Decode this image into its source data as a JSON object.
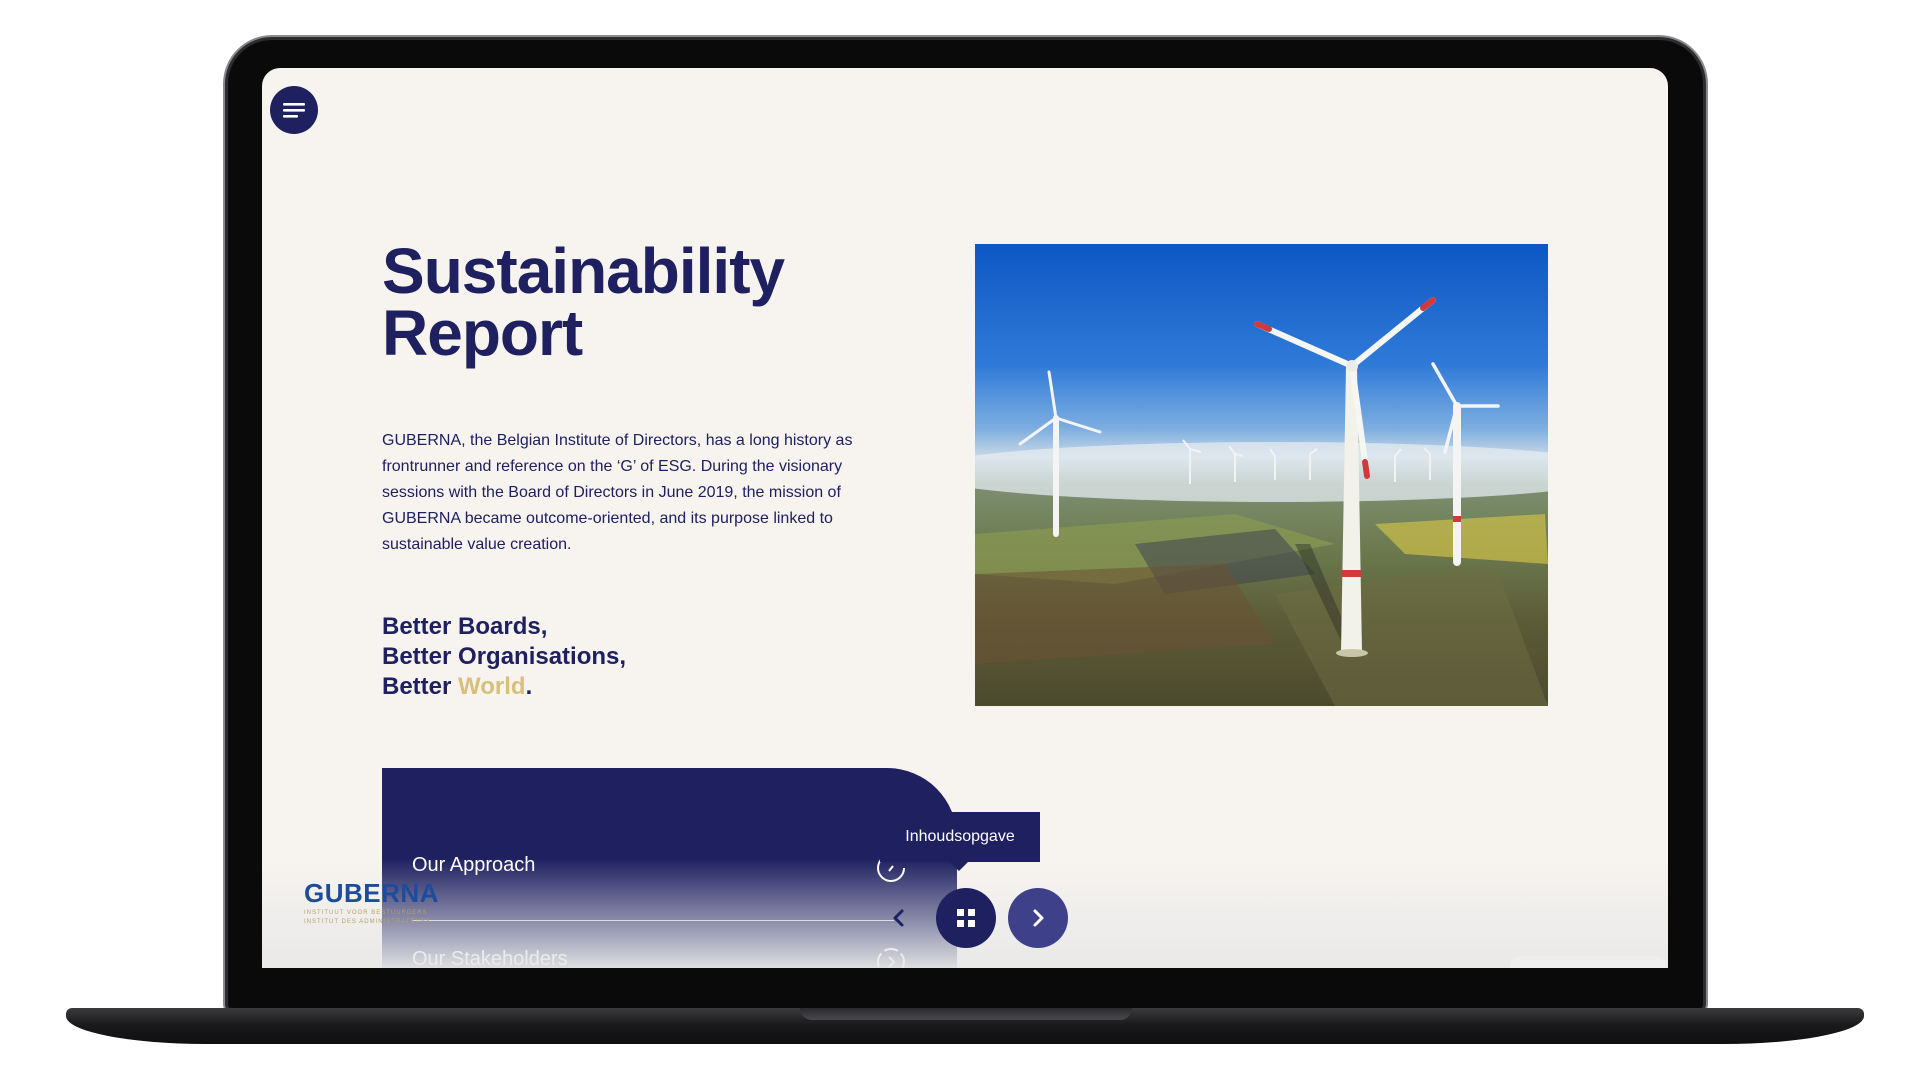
{
  "page": {
    "title_line1": "Sustainability",
    "title_line2": "Report",
    "intro": " GUBERNA, the Belgian Institute of Directors, has a long history as frontrunner and reference on the ‘G’ of ESG. During the visionary sessions with the Board of Directors in June 2019, the mission of GUBERNA became outcome-oriented, and its purpose linked to sustainable value creation.",
    "tagline": {
      "line1": "Better Boards,",
      "line2": "Better Organisations,",
      "line3_prefix": "Better ",
      "line3_highlight": "World",
      "line3_suffix": "."
    }
  },
  "toc": {
    "items": [
      {
        "label": "Our Approach"
      },
      {
        "label": "Our Stakeholders"
      }
    ],
    "tooltip": "Inhoudsopgave"
  },
  "logo": {
    "name": "GUBERNA",
    "sub1": "INSTITUUT VOOR BESTUURDERS",
    "sub2": "INSTITUT DES ADMINISTRATEURS"
  },
  "icons": {
    "menu": "menu-icon",
    "prev": "chevron-left-icon",
    "grid": "grid-icon",
    "next": "chevron-right-icon"
  },
  "colors": {
    "navy": "#1e2060",
    "gold": "#d8c07a",
    "background": "#f7f4ef"
  }
}
